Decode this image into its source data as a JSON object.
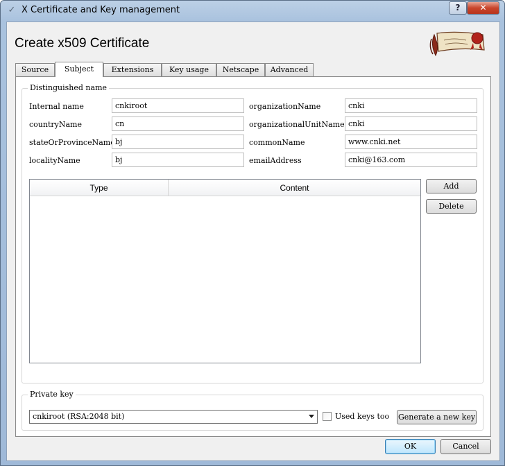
{
  "window": {
    "title": "X Certificate and Key management",
    "help_label": "?",
    "close_label": "✕"
  },
  "header": {
    "title": "Create x509 Certificate"
  },
  "tabs": [
    {
      "label": "Source"
    },
    {
      "label": "Subject"
    },
    {
      "label": "Extensions"
    },
    {
      "label": "Key usage"
    },
    {
      "label": "Netscape"
    },
    {
      "label": "Advanced"
    }
  ],
  "active_tab": "Subject",
  "distinguished_name": {
    "legend": "Distinguished name",
    "fields": [
      {
        "label": "Internal name",
        "value": "cnkiroot"
      },
      {
        "label": "countryName",
        "value": "cn"
      },
      {
        "label": "stateOrProvinceName",
        "value": "bj"
      },
      {
        "label": "localityName",
        "value": "bj"
      },
      {
        "label": "organizationName",
        "value": "cnki"
      },
      {
        "label": "organizationalUnitName",
        "value": "cnki"
      },
      {
        "label": "commonName",
        "value": "www.cnki.net"
      },
      {
        "label": "emailAddress",
        "value": "cnki@163.com"
      }
    ]
  },
  "table": {
    "columns": [
      "Type",
      "Content"
    ],
    "rows": []
  },
  "side_buttons": {
    "add": "Add",
    "delete": "Delete"
  },
  "private_key": {
    "legend": "Private key",
    "selected": "cnkiroot (RSA:2048 bit)",
    "used_keys_label": "Used keys too",
    "used_keys_checked": false,
    "generate_label": "Generate a new key"
  },
  "footer": {
    "ok": "OK",
    "cancel": "Cancel"
  },
  "icons": {
    "app": "certificate-app-icon",
    "logo": "scroll-seal-logo"
  }
}
